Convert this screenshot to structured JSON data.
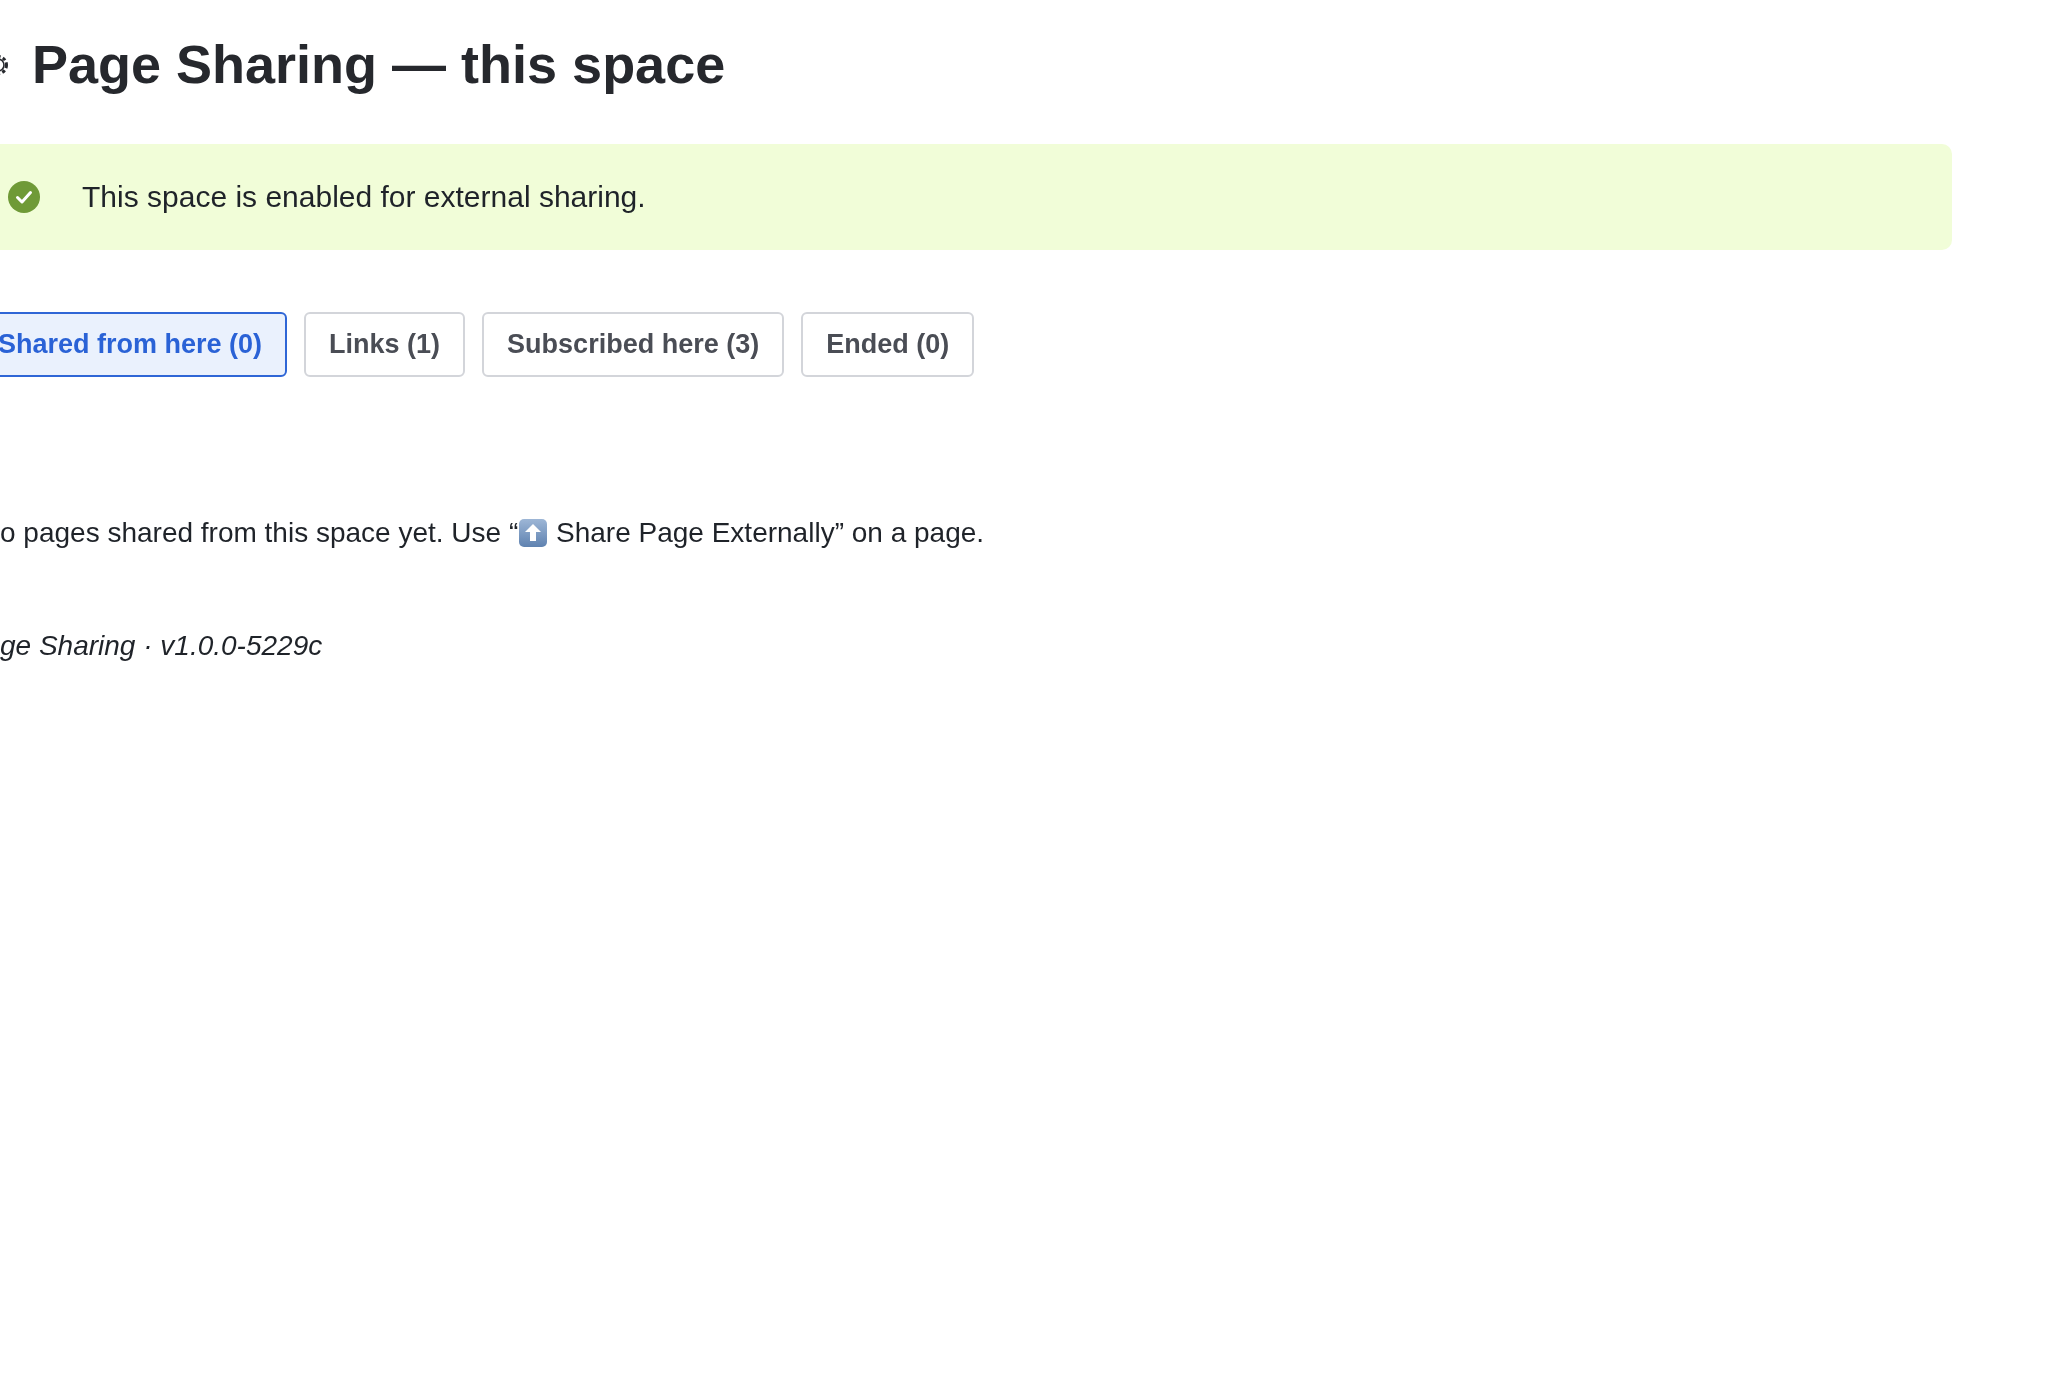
{
  "header": {
    "title": "Page Sharing — this space"
  },
  "notice": {
    "kind": "success",
    "message": "This space is enabled for external sharing."
  },
  "tabs": [
    {
      "label": "Shared from here (0)",
      "selected": true
    },
    {
      "label": "Links (1)",
      "selected": false
    },
    {
      "label": "Subscribed here (3)",
      "selected": false
    },
    {
      "label": "Ended (0)",
      "selected": false
    }
  ],
  "empty_state": {
    "text_before_icon": "o pages shared from this space yet. Use “",
    "text_after_icon": " Share Page Externally” on a page."
  },
  "footer": {
    "text": "ge Sharing · v1.0.0-5229c"
  }
}
